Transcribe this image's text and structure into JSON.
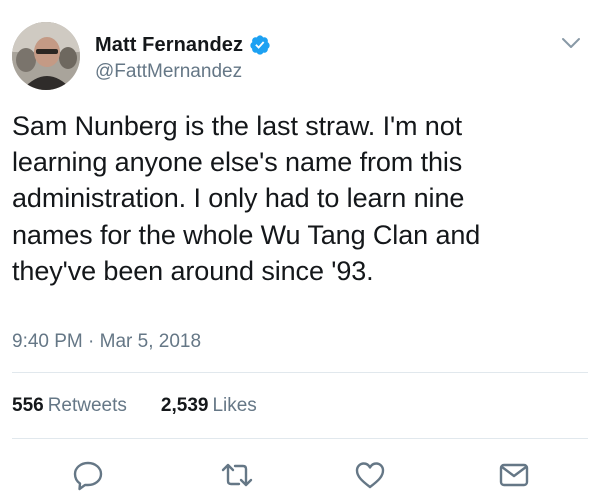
{
  "tweet": {
    "author": {
      "display_name": "Matt Fernandez",
      "handle": "@FattMernandez",
      "verified": true
    },
    "text": "Sam Nunberg is the last straw. I'm not\nlearning anyone else's name from this\nadministration. I only had to learn nine\nnames for the whole Wu Tang Clan and\nthey've been around since '93.",
    "timestamp": "9:40 PM · Mar 5, 2018",
    "stats": {
      "retweets_count": "556",
      "retweets_label": "Retweets",
      "likes_count": "2,539",
      "likes_label": "Likes"
    }
  },
  "icons": {
    "caret": "chevron-down-icon",
    "verified": "verified-badge-icon",
    "reply": "reply-icon",
    "retweet": "retweet-icon",
    "like": "heart-icon",
    "share": "envelope-icon"
  },
  "colors": {
    "text_primary": "#14171a",
    "text_secondary": "#657786",
    "verified_blue": "#1da1f2",
    "divider": "#e1e8ed"
  }
}
